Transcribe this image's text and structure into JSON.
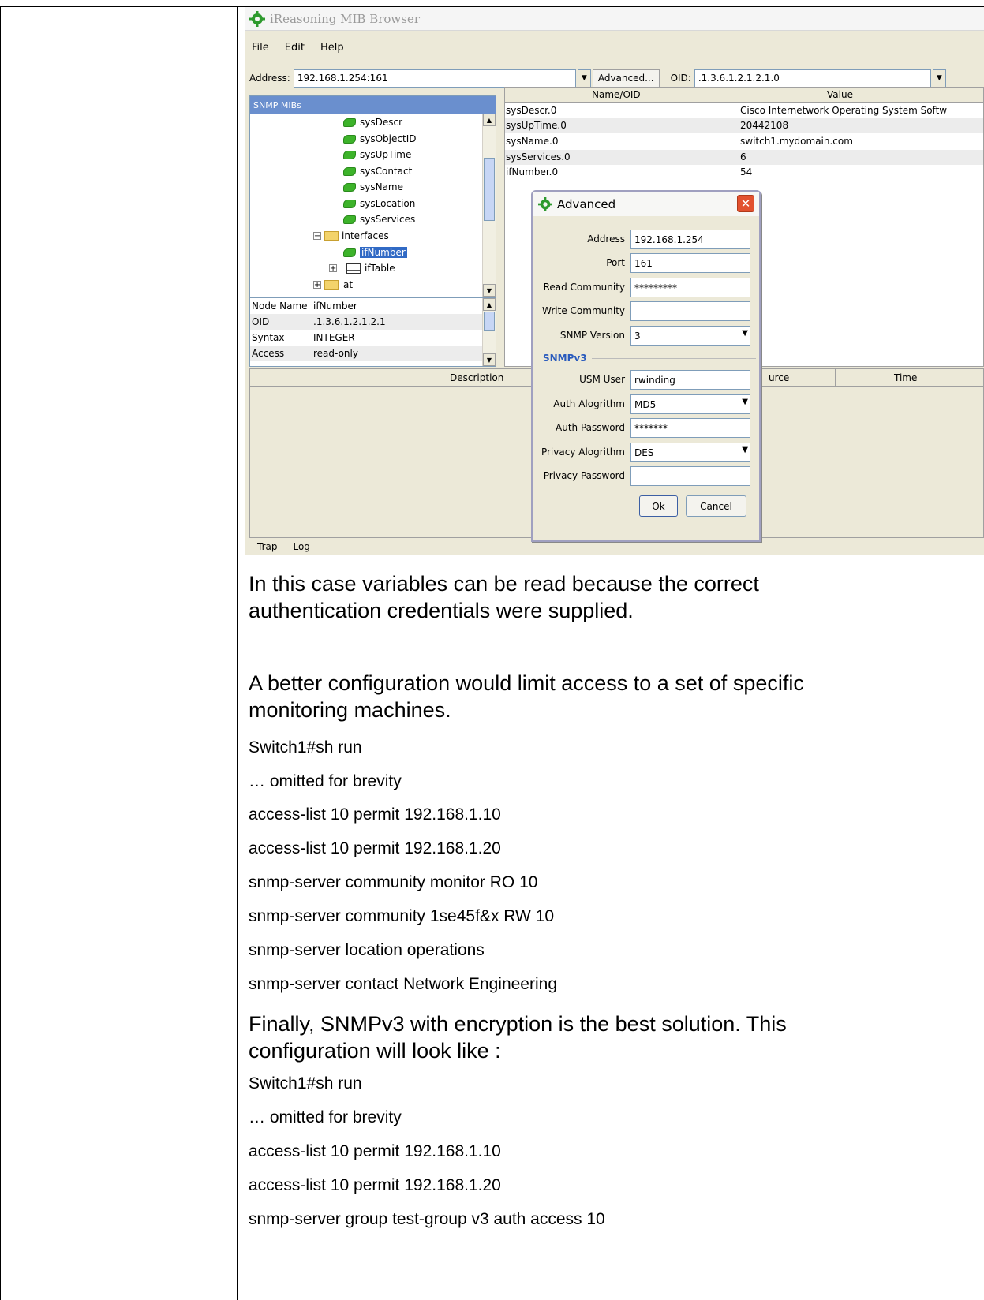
{
  "app": {
    "title": "iReasoning MIB Browser",
    "menu": [
      "File",
      "Edit",
      "Help"
    ],
    "address_label": "Address:",
    "address_value": "192.168.1.254:161",
    "advanced_button": "Advanced...",
    "oid_label": "OID:",
    "oid_value": ".1.3.6.1.2.1.2.1.0"
  },
  "tree": {
    "header": "SNMP MIBs",
    "items": [
      "sysDescr",
      "sysObjectID",
      "sysUpTime",
      "sysContact",
      "sysName",
      "sysLocation",
      "sysServices",
      "interfaces",
      "ifNumber",
      "ifTable",
      "at"
    ]
  },
  "props": {
    "rows": [
      {
        "key": "Node Name",
        "value": "ifNumber"
      },
      {
        "key": "OID",
        "value": ".1.3.6.1.2.1.2.1"
      },
      {
        "key": "Syntax",
        "value": "INTEGER"
      },
      {
        "key": "Access",
        "value": "read-only"
      }
    ]
  },
  "results": {
    "headers": [
      "Name/OID",
      "Value"
    ],
    "rows": [
      {
        "name": "sysDescr.0",
        "value": "Cisco Internetwork Operating System Softw"
      },
      {
        "name": "sysUpTime.0",
        "value": "20442108"
      },
      {
        "name": "sysName.0",
        "value": "switch1.mydomain.com"
      },
      {
        "name": "sysServices.0",
        "value": "6"
      },
      {
        "name": "ifNumber.0",
        "value": "54"
      }
    ]
  },
  "bottom": {
    "headers": [
      "Description",
      "urce",
      "Time"
    ],
    "tabs": [
      "Trap",
      "Log"
    ]
  },
  "dialog": {
    "title": "Advanced",
    "fields": [
      {
        "label": "Address",
        "value": "192.168.1.254"
      },
      {
        "label": "Port",
        "value": "161"
      },
      {
        "label": "Read Community",
        "value": "*********"
      },
      {
        "label": "Write Community",
        "value": ""
      },
      {
        "label": "SNMP Version",
        "value": "3"
      }
    ],
    "section": "SNMPv3",
    "v3fields": [
      {
        "label": "USM User",
        "value": "rwinding"
      },
      {
        "label": "Auth Alogrithm",
        "value": "MD5"
      },
      {
        "label": "Auth Password",
        "value": "*******"
      },
      {
        "label": "Privacy Alogrithm",
        "value": "DES"
      },
      {
        "label": "Privacy Password",
        "value": ""
      }
    ],
    "ok": "Ok",
    "cancel": "Cancel"
  },
  "doc": {
    "para1": "In this case variables can be read because the correct authentication credentials were supplied.",
    "para2": "A better configuration would limit access to a set of specific monitoring machines.",
    "config1": [
      "Switch1#sh run",
      "… omitted for brevity",
      "access-list 10 permit 192.168.1.10",
      "access-list 10 permit 192.168.1.20",
      "snmp-server community monitor RO 10",
      "snmp-server community 1se45f&x RW 10",
      "snmp-server location operations",
      "snmp-server contact Network Engineering"
    ],
    "para3": "Finally, SNMPv3 with encryption is the best solution. This configuration will look like :",
    "config2": [
      "Switch1#sh run",
      "… omitted for brevity",
      "access-list 10 permit 192.168.1.10",
      "access-list 10 permit 192.168.1.20",
      "snmp-server group test-group v3 auth access 10"
    ]
  }
}
